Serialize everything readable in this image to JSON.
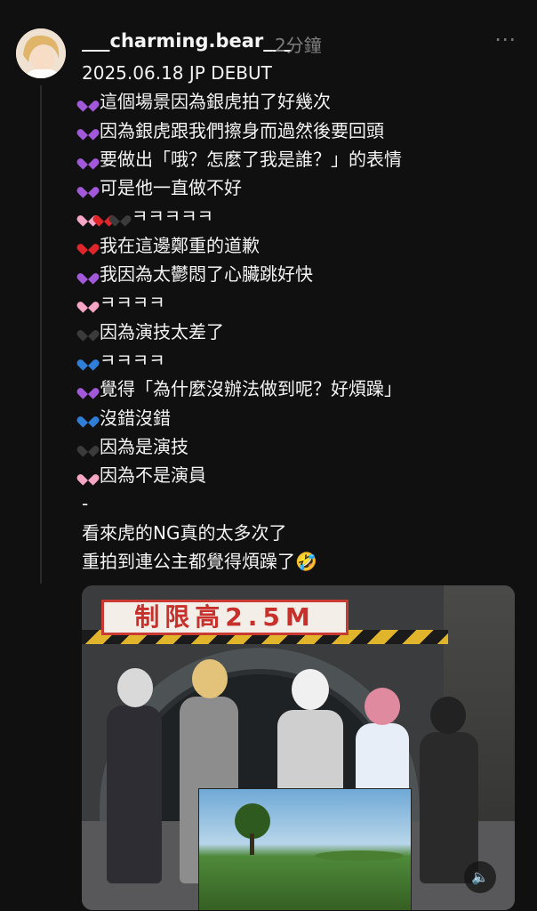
{
  "post": {
    "username": "___charming.bear___",
    "time": "2分鐘",
    "more_icon": "more-icon",
    "lines": [
      {
        "hearts": [],
        "text": "2025.06.18 JP DEBUT"
      },
      {
        "hearts": [
          "#a259d9"
        ],
        "text": "這個場景因為銀虎拍了好幾次"
      },
      {
        "hearts": [
          "#a259d9"
        ],
        "text": "因為銀虎跟我們擦身而過然後要回頭"
      },
      {
        "hearts": [
          "#a259d9"
        ],
        "text": "要做出「哦？怎麼了我是誰？」的表情"
      },
      {
        "hearts": [
          "#a259d9"
        ],
        "text": "可是他一直做不好"
      },
      {
        "hearts": [
          "#f6a6c4",
          "#e0262b",
          "#3b3b3b"
        ],
        "text": "ㅋㅋㅋㅋㅋ"
      },
      {
        "hearts": [
          "#e0262b"
        ],
        "text": "我在這邊鄭重的道歉"
      },
      {
        "hearts": [
          "#a259d9"
        ],
        "text": "我因為太鬱悶了心臟跳好快"
      },
      {
        "hearts": [
          "#f6a6c4"
        ],
        "text": "ㅋㅋㅋㅋ"
      },
      {
        "hearts": [
          "#3b3b3b"
        ],
        "text": "因為演技太差了"
      },
      {
        "hearts": [
          "#2f7fd9"
        ],
        "text": "ㅋㅋㅋㅋ"
      },
      {
        "hearts": [
          "#a259d9"
        ],
        "text": "覺得「為什麼沒辦法做到呢？好煩躁」"
      },
      {
        "hearts": [
          "#2f7fd9"
        ],
        "text": "沒錯沒錯"
      },
      {
        "hearts": [
          "#3b3b3b"
        ],
        "text": "因為是演技"
      },
      {
        "hearts": [
          "#f6a6c4"
        ],
        "text": "因為不是演員"
      },
      {
        "hearts": [],
        "text": "-"
      },
      {
        "hearts": [],
        "text": "看來虎的NG真的太多次了"
      },
      {
        "hearts": [],
        "text": "重拍到連公主都覺得煩躁了🤣"
      }
    ]
  },
  "media": {
    "sign_text": "制限高2.5M",
    "sound_icon": "volume-icon"
  },
  "colors": {
    "background": "#101010",
    "text": "#f3f3f3",
    "muted": "#7d7d7d"
  }
}
